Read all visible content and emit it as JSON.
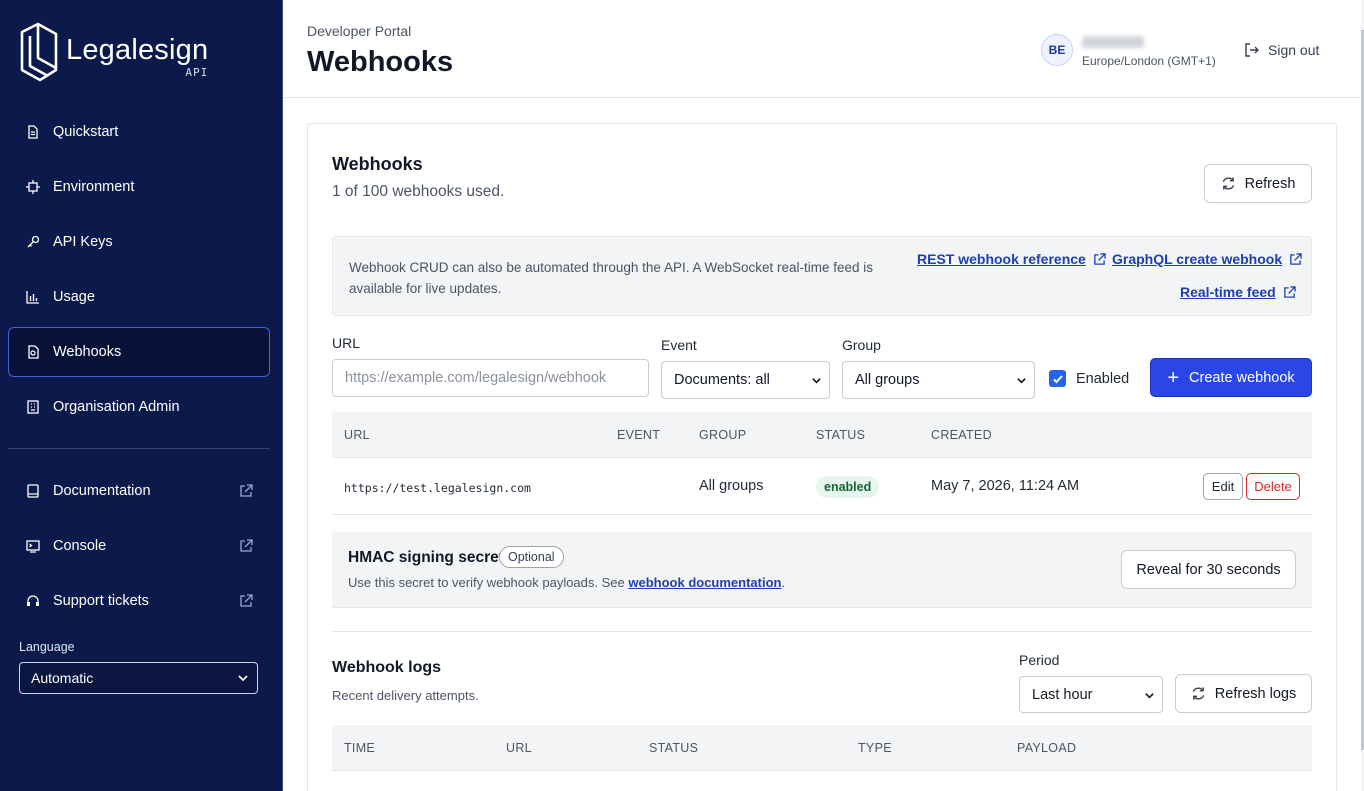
{
  "brand": {
    "name": "Legalesign",
    "sub": "API"
  },
  "sidebar": {
    "items": [
      {
        "label": "Quickstart",
        "icon": "document-icon"
      },
      {
        "label": "Environment",
        "icon": "environment-icon"
      },
      {
        "label": "API Keys",
        "icon": "key-icon"
      },
      {
        "label": "Usage",
        "icon": "bar-chart-icon"
      },
      {
        "label": "Webhooks",
        "icon": "webhook-icon",
        "active": true
      },
      {
        "label": "Organisation Admin",
        "icon": "building-icon"
      }
    ],
    "external": [
      {
        "label": "Documentation",
        "icon": "book-icon"
      },
      {
        "label": "Console",
        "icon": "terminal-icon"
      },
      {
        "label": "Support tickets",
        "icon": "headset-icon"
      }
    ],
    "language_label": "Language",
    "language_value": "Automatic"
  },
  "header": {
    "breadcrumb": "Developer Portal",
    "title": "Webhooks",
    "avatar_initials": "BE",
    "timezone": "Europe/London (GMT+1)",
    "signout": "Sign out"
  },
  "webhooks": {
    "title": "Webhooks",
    "usage": "1 of 100 webhooks used.",
    "refresh": "Refresh",
    "info_text": "Webhook CRUD can also be automated through the API. A WebSocket real-time feed is available for live updates.",
    "links": {
      "rest": "REST webhook reference",
      "graphql": "GraphQL create webhook",
      "realtime": "Real-time feed"
    },
    "form": {
      "url_label": "URL",
      "url_placeholder": "https://example.com/legalesign/webhook",
      "event_label": "Event",
      "event_value": "Documents: all",
      "group_label": "Group",
      "group_value": "All groups",
      "enabled_label": "Enabled",
      "create_button": "Create webhook"
    },
    "table": {
      "headers": [
        "URL",
        "EVENT",
        "GROUP",
        "STATUS",
        "CREATED"
      ],
      "rows": [
        {
          "url": "https://test.legalesign.com",
          "event": "",
          "group": "All groups",
          "status": "enabled",
          "created": "May 7, 2026, 11:24 AM",
          "edit": "Edit",
          "delete": "Delete"
        }
      ]
    },
    "hmac": {
      "title": "HMAC signing secret",
      "badge": "Optional",
      "text": "Use this secret to verify webhook payloads. See ",
      "link": "webhook documentation",
      "suffix": ".",
      "reveal": "Reveal for 30 seconds"
    }
  },
  "logs": {
    "title": "Webhook logs",
    "subtitle": "Recent delivery attempts.",
    "period_label": "Period",
    "period_value": "Last hour",
    "refresh": "Refresh logs",
    "headers": [
      "TIME",
      "URL",
      "STATUS",
      "TYPE",
      "PAYLOAD"
    ]
  },
  "colors": {
    "sidebar_bg": "#0c1a4b",
    "primary": "#2b46e6",
    "link": "#1e40af",
    "danger": "#dc2626",
    "success_bg": "#e7f6ec"
  }
}
